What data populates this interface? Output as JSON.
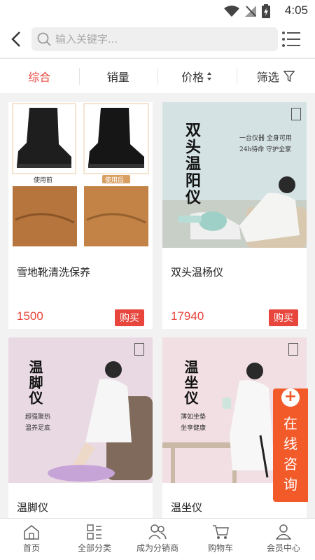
{
  "status_bar": {
    "time": "4:05"
  },
  "header": {
    "search_placeholder": "输入关键字..."
  },
  "sort_tabs": [
    {
      "label": "综合",
      "active": true
    },
    {
      "label": "销量",
      "active": false
    },
    {
      "label": "价格",
      "active": false
    },
    {
      "label": "筛选",
      "active": false
    }
  ],
  "products": [
    {
      "title": "雪地靴清洗保养",
      "price": "1500",
      "buy": "购买",
      "img_before": "使用前",
      "img_after": "使用后"
    },
    {
      "title": "双头温杨仪",
      "price": "17940",
      "buy": "购买",
      "img_heading": "双头温阳仪",
      "img_lines": [
        "一台仪器 全身可用",
        "24h待命 守护全家"
      ]
    },
    {
      "title": "温脚仪",
      "img_heading": "温脚仪",
      "img_lines": [
        "超强聚热",
        "温养足底"
      ]
    },
    {
      "title": "温坐仪",
      "img_heading": "温坐仪",
      "img_lines": [
        "薄如坐垫",
        "坐享健康"
      ]
    }
  ],
  "consult": {
    "label": "在线咨询"
  },
  "tabbar": [
    {
      "label": "首页",
      "icon": "home-icon"
    },
    {
      "label": "全部分类",
      "icon": "category-icon"
    },
    {
      "label": "成为分销商",
      "icon": "users-icon"
    },
    {
      "label": "购物车",
      "icon": "cart-icon"
    },
    {
      "label": "会员中心",
      "icon": "user-icon"
    }
  ],
  "colors": {
    "accent": "#e8453c",
    "consult": "#f25a2a"
  }
}
